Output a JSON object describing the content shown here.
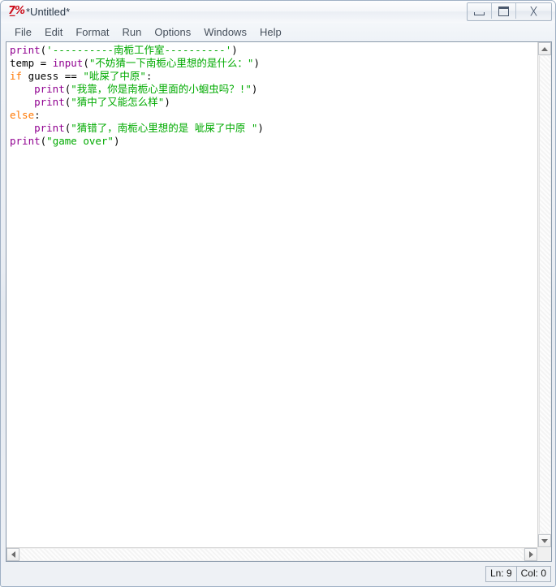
{
  "window": {
    "title": "*Untitled*",
    "icon": "idle-python-logo",
    "controls": {
      "minimize": "minimize-button",
      "maximize": "maximize-button",
      "close": "close-button"
    }
  },
  "menubar": {
    "items": [
      {
        "label": "File"
      },
      {
        "label": "Edit"
      },
      {
        "label": "Format"
      },
      {
        "label": "Run"
      },
      {
        "label": "Options"
      },
      {
        "label": "Windows"
      },
      {
        "label": "Help"
      }
    ]
  },
  "editor": {
    "lines": [
      [
        {
          "t": "print",
          "c": "builtin"
        },
        {
          "t": "(",
          "c": "punct"
        },
        {
          "t": "'----------南栀工作室----------'",
          "c": "string"
        },
        {
          "t": ")",
          "c": "punct"
        }
      ],
      [
        {
          "t": "temp ",
          "c": "plain"
        },
        {
          "t": "= ",
          "c": "plain"
        },
        {
          "t": "input",
          "c": "builtin"
        },
        {
          "t": "(",
          "c": "punct"
        },
        {
          "t": "\"不妨猜一下南栀心里想的是什么：\"",
          "c": "string"
        },
        {
          "t": ")",
          "c": "punct"
        }
      ],
      [
        {
          "t": "if",
          "c": "keyword"
        },
        {
          "t": " guess == ",
          "c": "plain"
        },
        {
          "t": "\"呲屎了中原\"",
          "c": "string"
        },
        {
          "t": ":",
          "c": "punct"
        }
      ],
      [
        {
          "t": "    ",
          "c": "plain"
        },
        {
          "t": "print",
          "c": "builtin"
        },
        {
          "t": "(",
          "c": "punct"
        },
        {
          "t": "\"我靠，你是南栀心里面的小蛔虫吗？!\"",
          "c": "string"
        },
        {
          "t": ")",
          "c": "punct"
        }
      ],
      [
        {
          "t": "    ",
          "c": "plain"
        },
        {
          "t": "print",
          "c": "builtin"
        },
        {
          "t": "(",
          "c": "punct"
        },
        {
          "t": "\"猜中了又能怎么样\"",
          "c": "string"
        },
        {
          "t": ")",
          "c": "punct"
        }
      ],
      [
        {
          "t": "else",
          "c": "keyword"
        },
        {
          "t": ":",
          "c": "punct"
        }
      ],
      [
        {
          "t": "    ",
          "c": "plain"
        },
        {
          "t": "print",
          "c": "builtin"
        },
        {
          "t": "(",
          "c": "punct"
        },
        {
          "t": "\"猜错了，南栀心里想的是 呲屎了中原 \"",
          "c": "string"
        },
        {
          "t": ")",
          "c": "punct"
        }
      ],
      [
        {
          "t": "print",
          "c": "builtin"
        },
        {
          "t": "(",
          "c": "punct"
        },
        {
          "t": "\"game over\"",
          "c": "string"
        },
        {
          "t": ")",
          "c": "punct"
        }
      ]
    ]
  },
  "statusbar": {
    "line": "Ln: 9",
    "column": "Col: 0"
  },
  "colors": {
    "builtin": "#900090",
    "keyword": "#ff7700",
    "string": "#00aa00",
    "plain": "#000000",
    "titlebar_icon": "#cc0e1b"
  }
}
